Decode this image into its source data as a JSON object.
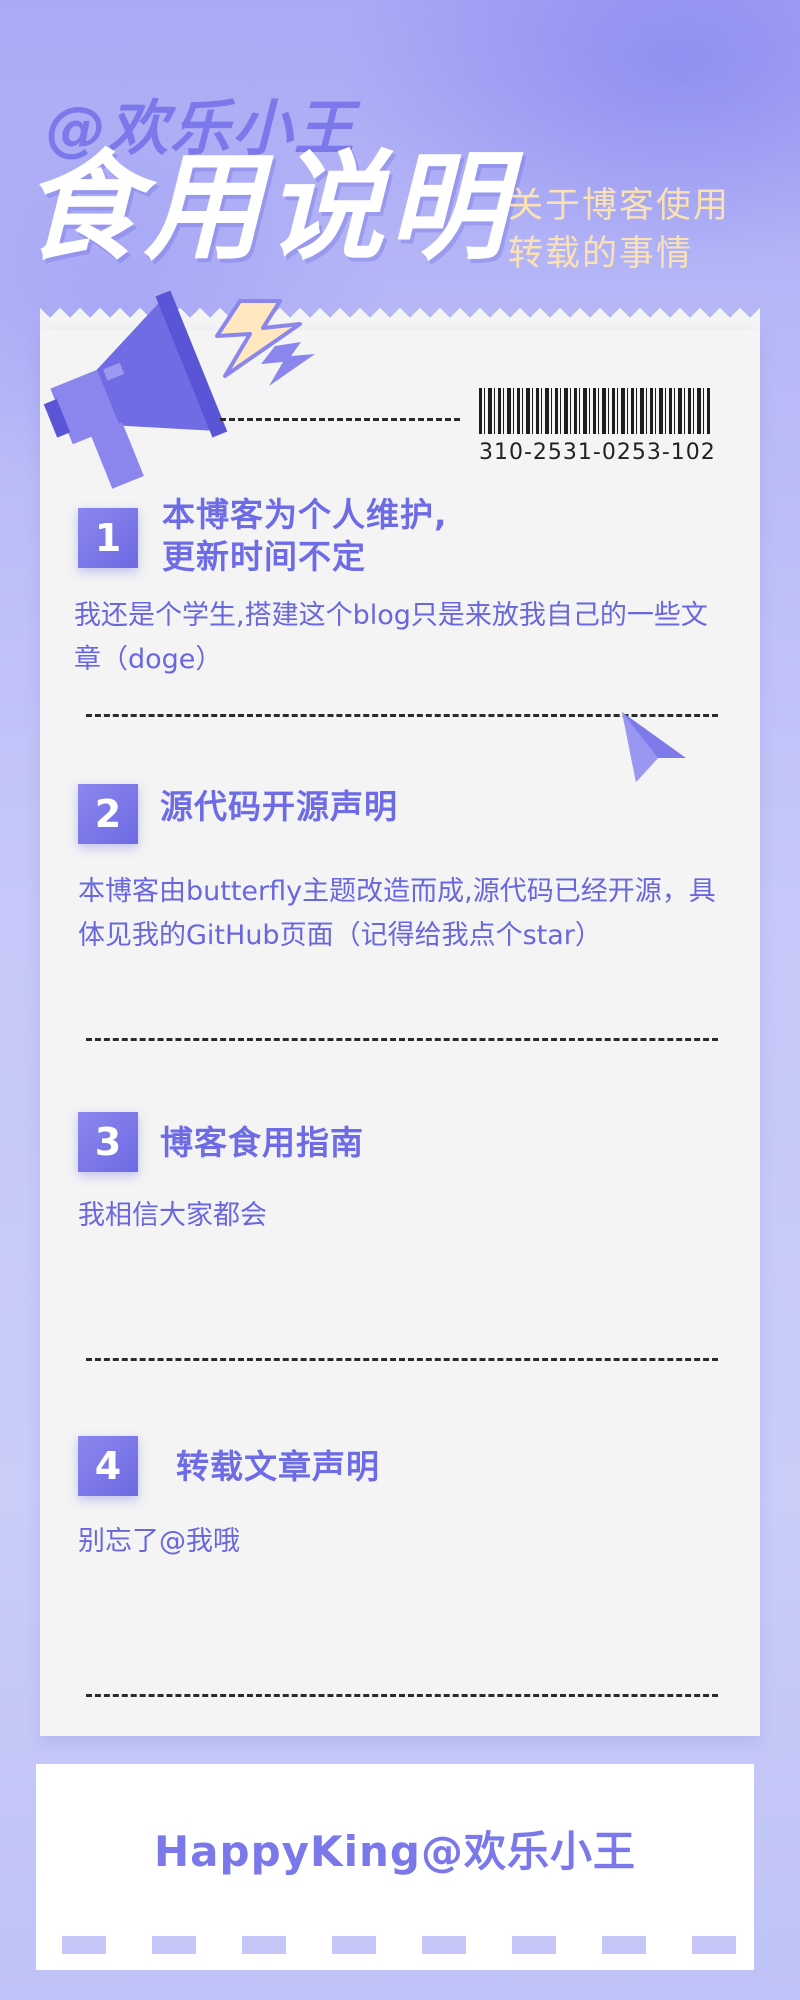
{
  "header": {
    "handle": "@欢乐小王",
    "title": "食用说明",
    "subtitle": "关于博客使用转载的事情"
  },
  "ticket": {
    "barcode_number": "310-2531-0253-102"
  },
  "sections": [
    {
      "number": "1",
      "title_line1": "本博客为个人维护,",
      "title_line2": "更新时间不定",
      "body": "我还是个学生,搭建这个blog只是来放我自己的一些文章（doge）"
    },
    {
      "number": "2",
      "title": "源代码开源声明",
      "body": "本博客由butterfly主题改造而成,源代码已经开源，具体见我的GitHub页面（记得给我点个star）"
    },
    {
      "number": "3",
      "title": "博客食用指南",
      "body": "我相信大家都会"
    },
    {
      "number": "4",
      "title": "转载文章声明",
      "body": "别忘了@我哦"
    }
  ],
  "footer": {
    "signature": "HappyKing@欢乐小王"
  },
  "colors": {
    "accent": "#6d6be6",
    "subtitle": "#fbe2b3",
    "ticket": "#f4f4f5"
  },
  "icons": [
    "megaphone-icon",
    "lightning-icon",
    "cursor-arrow-icon",
    "barcode"
  ]
}
